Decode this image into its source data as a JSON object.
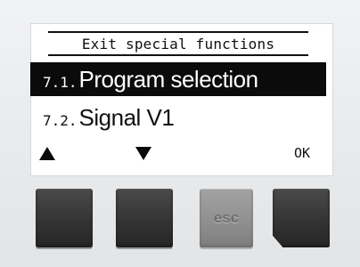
{
  "screen": {
    "header": "Exit special functions",
    "menu": [
      {
        "number": "7.1.",
        "label": "Program selection",
        "selected": true
      },
      {
        "number": "7.2.",
        "label": "Signal V1",
        "selected": false
      }
    ],
    "softkeys": {
      "up_icon": "triangle-up-icon",
      "down_icon": "triangle-down-icon",
      "ok_label": "OK"
    }
  },
  "buttons": {
    "esc_label": "esc"
  },
  "colors": {
    "lcd_background": "#ffffff",
    "selection_bar": "#0b0b0b",
    "key_dark": "#333333",
    "key_esc": "#8e8e8e",
    "housing": "#eceef0"
  }
}
